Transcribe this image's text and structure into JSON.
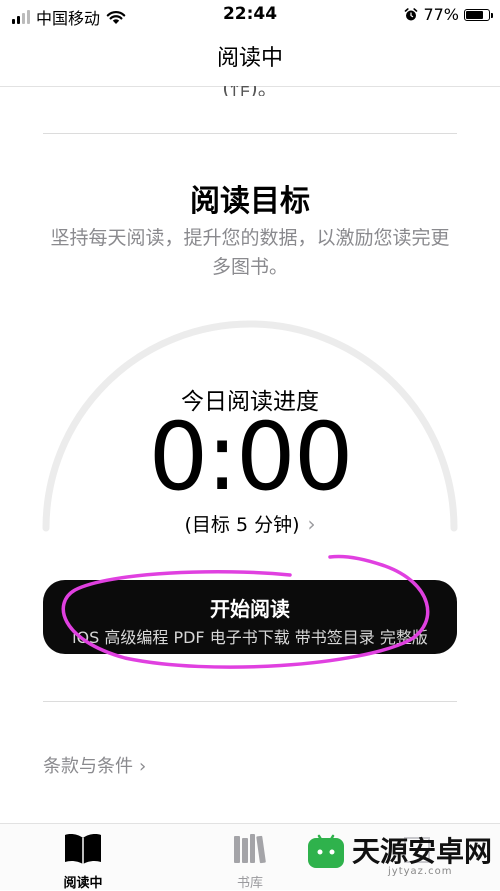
{
  "status_bar": {
    "carrier": "中国移动",
    "time": "22:44",
    "battery_percent": "77%",
    "battery_level": 0.77
  },
  "nav": {
    "title": "阅读中"
  },
  "peek_text": "(作)。",
  "goal": {
    "title": "阅读目标",
    "description": "坚持每天阅读，提升您的数据，以激励您读完更多图书。"
  },
  "progress": {
    "label": "今日阅读进度",
    "time": "0:00",
    "target": "(目标 5 分钟)",
    "fraction": 0
  },
  "start_button": {
    "label": "开始阅读",
    "book": "iOS 高级编程 PDF 电子书下载 带书签目录 完整版"
  },
  "terms": {
    "label": "条款与条件"
  },
  "tab_bar": {
    "items": [
      {
        "label": "阅读中",
        "icon": "book-open-icon",
        "active": true
      },
      {
        "label": "书库",
        "icon": "library-icon",
        "active": false
      },
      {
        "label": "",
        "icon": "bookstore-icon",
        "active": false
      }
    ]
  },
  "watermark": {
    "text": "天源安卓网",
    "url": "jytyaz.com"
  },
  "colors": {
    "annotation": "#e040e0",
    "button_bg": "#0b0b0b",
    "secondary_text": "#8a8a8e",
    "ring": "#ececec"
  }
}
